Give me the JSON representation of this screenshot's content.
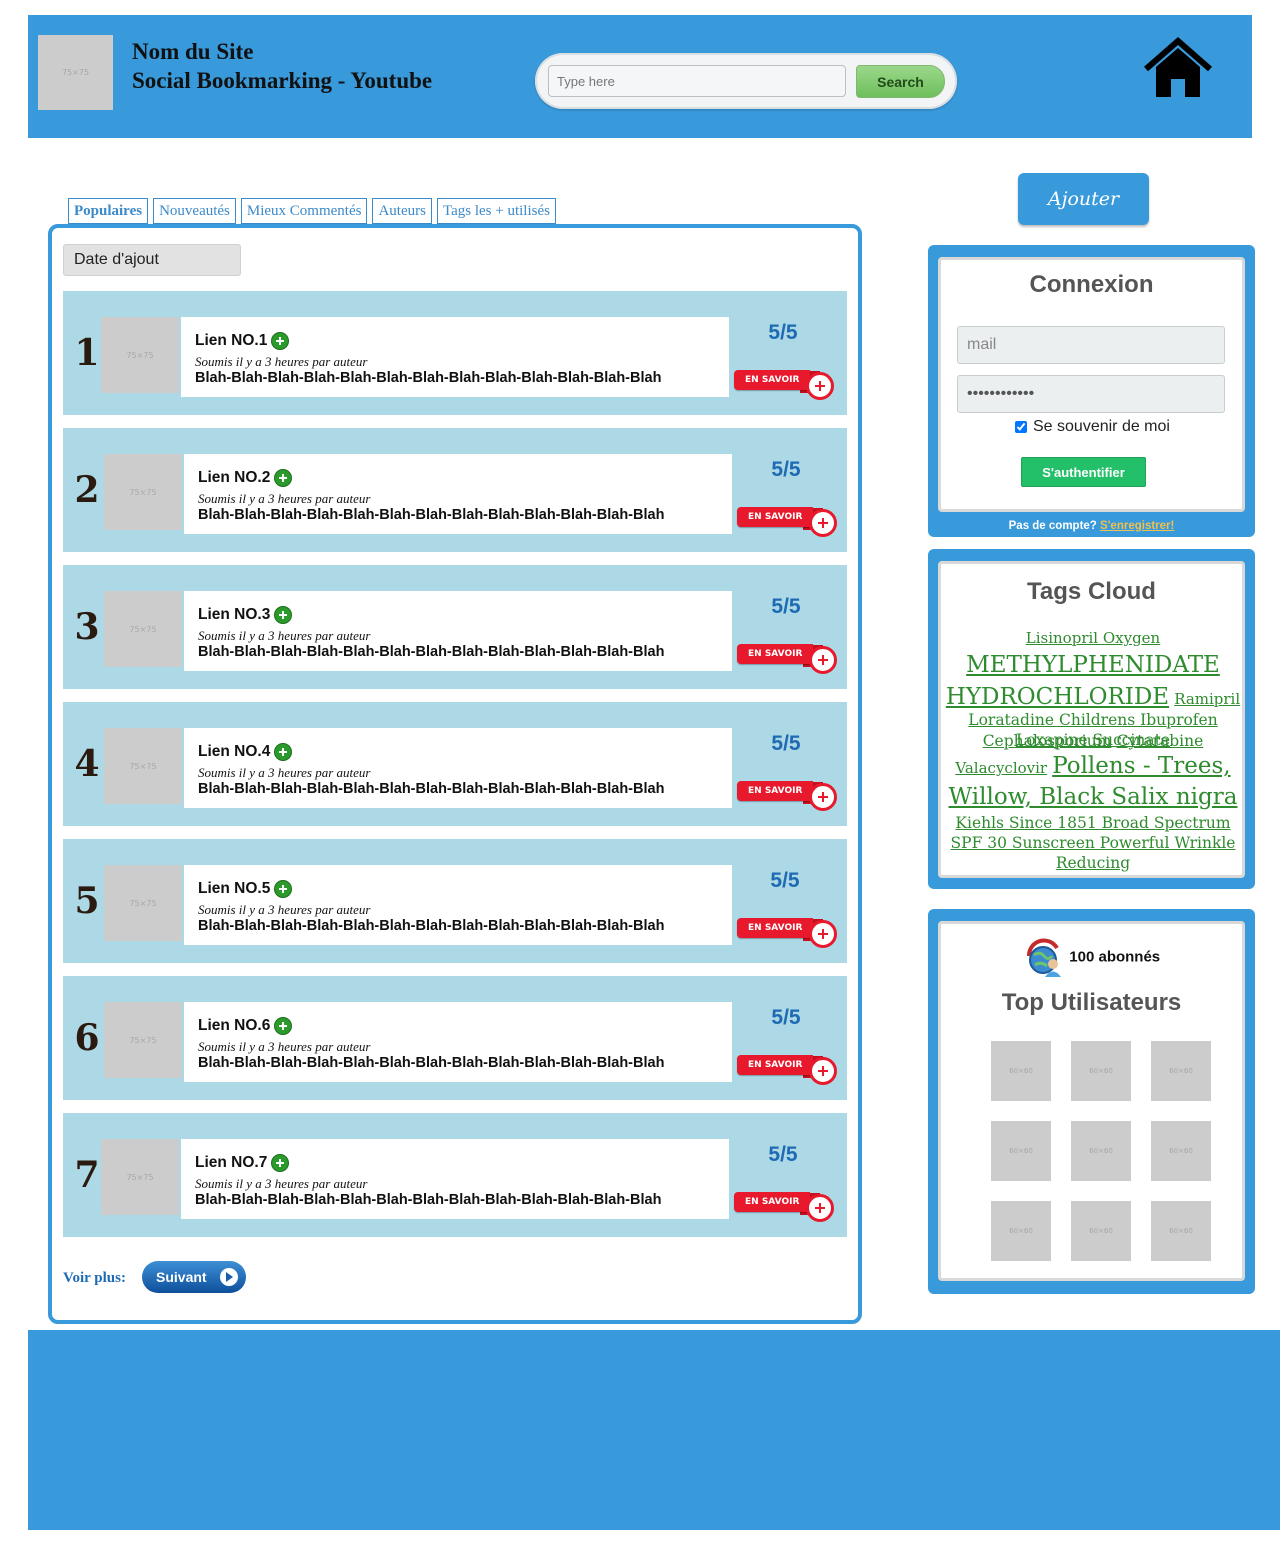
{
  "header": {
    "logo_placeholder": "75×75",
    "site_name": "Nom du Site",
    "site_subtitle": "Social Bookmarking - Youtube",
    "search_placeholder": "Type here",
    "search_button": "Search",
    "home_icon": "home-icon"
  },
  "tabs": [
    {
      "label": "Populaires",
      "active": true
    },
    {
      "label": "Nouveautés",
      "active": false
    },
    {
      "label": "Mieux Commentés",
      "active": false
    },
    {
      "label": "Auteurs",
      "active": false
    },
    {
      "label": "Tags les + utilisés",
      "active": false
    }
  ],
  "main": {
    "sort_button": "Date d'ajout",
    "thumb_placeholder": "75×75",
    "links": [
      {
        "rank": "1",
        "title": "Lien NO.1",
        "submitted": "Soumis il y a 3 heures par auteur",
        "description": "Blah-Blah-Blah-Blah-Blah-Blah-Blah-Blah-Blah-Blah-Blah-Blah-Blah",
        "score": "5/5",
        "more_button": "EN SAVOIR"
      },
      {
        "rank": "2",
        "title": "Lien NO.2",
        "submitted": "Soumis il y a 3 heures par auteur",
        "description": "Blah-Blah-Blah-Blah-Blah-Blah-Blah-Blah-Blah-Blah-Blah-Blah-Blah",
        "score": "5/5",
        "more_button": "EN SAVOIR"
      },
      {
        "rank": "3",
        "title": "Lien NO.3",
        "submitted": "Soumis il y a 3 heures par auteur",
        "description": "Blah-Blah-Blah-Blah-Blah-Blah-Blah-Blah-Blah-Blah-Blah-Blah-Blah",
        "score": "5/5",
        "more_button": "EN SAVOIR"
      },
      {
        "rank": "4",
        "title": "Lien NO.4",
        "submitted": "Soumis il y a 3 heures par auteur",
        "description": "Blah-Blah-Blah-Blah-Blah-Blah-Blah-Blah-Blah-Blah-Blah-Blah-Blah",
        "score": "5/5",
        "more_button": "EN SAVOIR"
      },
      {
        "rank": "5",
        "title": "Lien NO.5",
        "submitted": "Soumis il y a 3 heures par auteur",
        "description": "Blah-Blah-Blah-Blah-Blah-Blah-Blah-Blah-Blah-Blah-Blah-Blah-Blah",
        "score": "5/5",
        "more_button": "EN SAVOIR"
      },
      {
        "rank": "6",
        "title": "Lien NO.6",
        "submitted": "Soumis il y a 3 heures par auteur",
        "description": "Blah-Blah-Blah-Blah-Blah-Blah-Blah-Blah-Blah-Blah-Blah-Blah-Blah",
        "score": "5/5",
        "more_button": "EN SAVOIR"
      },
      {
        "rank": "7",
        "title": "Lien NO.7",
        "submitted": "Soumis il y a 3 heures par auteur",
        "description": "Blah-Blah-Blah-Blah-Blah-Blah-Blah-Blah-Blah-Blah-Blah-Blah-Blah",
        "score": "5/5",
        "more_button": "EN SAVOIR"
      }
    ],
    "more_label": "Voir plus:",
    "next_button": "Suivant"
  },
  "sidebar": {
    "add_button": "Ajouter",
    "login": {
      "title": "Connexion",
      "email_placeholder": "mail",
      "password_value": "............",
      "remember_label": "Se souvenir de moi",
      "remember_checked": true,
      "submit_button": "S'authentifier",
      "no_account": "Pas de compte?",
      "register_link": "S'enregistrer!"
    },
    "tags": {
      "title": "Tags Cloud",
      "items": [
        "Lisinopril Oxygen",
        "METHYLPHENIDATE HYDROCHLORIDE",
        "Ramipril",
        "Loratadine Childrens Ibuprofen",
        "Loxapine Succinate",
        "Cephalosporium",
        "Cytarabine",
        "Valacyclovir",
        "Pollens - Trees, Willow, Black Salix nigra",
        "Kiehls Since 1851 Broad Spectrum SPF 30 Sunscreen Powerful Wrinkle Reducing"
      ]
    },
    "users": {
      "followers": "100 abonnés",
      "title": "Top Utilisateurs",
      "avatar_placeholder": "60×60",
      "avatars": [
        "60×60",
        "60×60",
        "60×60",
        "60×60",
        "60×60",
        "60×60",
        "60×60",
        "60×60",
        "60×60"
      ]
    }
  },
  "colors": {
    "brand_blue": "#3899db",
    "row_bg": "#add8e6",
    "score_blue": "#1f6bb3",
    "tag_green": "#2e8b2e",
    "cta_red": "#e8192c",
    "auth_green": "#23c069"
  }
}
